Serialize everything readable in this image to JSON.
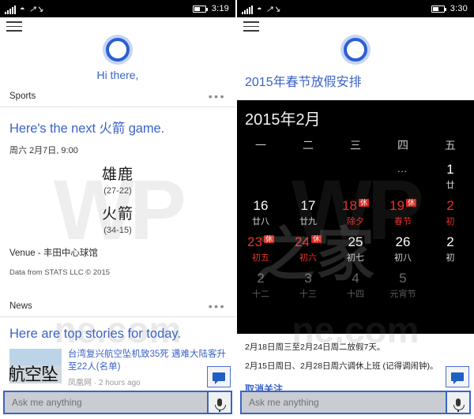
{
  "left": {
    "statusbar": {
      "time": "3:19",
      "signal_icon": "signal-bars-icon",
      "wifi_icon": "wifi-icon",
      "data_icon": "data-icon",
      "battery_icon": "battery-icon"
    },
    "menu_icon": "hamburger-menu-icon",
    "cortana_icon": "cortana-ring-icon",
    "greeting": "Hi there,",
    "sports": {
      "section_title": "Sports",
      "overflow_icon": "more-options-icon",
      "headline": "Here's the next 火箭 game.",
      "gametime": "周六 2月7日, 9:00",
      "teams": [
        {
          "name": "雄鹿",
          "record": "(27-22)"
        },
        {
          "name": "火箭",
          "record": "(34-15)"
        }
      ],
      "venue": "Venue - 丰田中心球馆",
      "data_source": "Data from STATS LLC © 2015"
    },
    "news": {
      "section_title": "News",
      "overflow_icon": "more-options-icon",
      "headline": "Here are top stories for today.",
      "items": [
        {
          "thumb_text": "航空坠",
          "title": "台湾复兴航空坠机致35死 遇难大陆客升至22人(名单)",
          "source": "凤凰网 · 2 hours ago"
        }
      ]
    },
    "chat_button_icon": "speech-bubble-icon",
    "ask_placeholder": "Ask me anything",
    "mic_icon": "microphone-icon"
  },
  "right": {
    "statusbar": {
      "time": "3:30",
      "signal_icon": "signal-bars-icon",
      "wifi_icon": "wifi-icon",
      "data_icon": "data-icon",
      "battery_icon": "battery-icon"
    },
    "menu_icon": "hamburger-menu-icon",
    "cortana_icon": "cortana-ring-icon",
    "title": "2015年春节放假安排",
    "calendar": {
      "month_label": "2015年2月",
      "weekdays": [
        "一",
        "二",
        "三",
        "四",
        "五"
      ],
      "rows": [
        [
          {
            "day": "",
            "lunar": "",
            "style": "blank"
          },
          {
            "day": "",
            "lunar": "",
            "style": "blank"
          },
          {
            "day": "",
            "lunar": "",
            "style": "blank"
          },
          {
            "day": "…",
            "lunar": "",
            "style": "ellipsis"
          },
          {
            "day": "1",
            "lunar": "廿",
            "style": "normal"
          }
        ],
        [
          {
            "day": "16",
            "lunar": "廿八",
            "style": "normal"
          },
          {
            "day": "17",
            "lunar": "廿九",
            "style": "normal"
          },
          {
            "day": "18",
            "lunar": "除夕",
            "style": "red",
            "badge": "休"
          },
          {
            "day": "19",
            "lunar": "春节",
            "style": "red",
            "badge": "休"
          },
          {
            "day": "2",
            "lunar": "初",
            "style": "red"
          }
        ],
        [
          {
            "day": "23",
            "lunar": "初五",
            "style": "red",
            "badge": "休"
          },
          {
            "day": "24",
            "lunar": "初六",
            "style": "red",
            "badge": "休"
          },
          {
            "day": "25",
            "lunar": "初七",
            "style": "normal"
          },
          {
            "day": "26",
            "lunar": "初八",
            "style": "normal"
          },
          {
            "day": "2",
            "lunar": "初",
            "style": "normal"
          }
        ],
        [
          {
            "day": "2",
            "lunar": "十二",
            "style": "dim"
          },
          {
            "day": "3",
            "lunar": "十三",
            "style": "dim"
          },
          {
            "day": "4",
            "lunar": "十四",
            "style": "dim"
          },
          {
            "day": "5",
            "lunar": "元宵节",
            "style": "dim"
          },
          {
            "day": "",
            "lunar": "",
            "style": "dim"
          }
        ]
      ]
    },
    "note1": "2月18日周三至2月24日周二放假7天。",
    "note2": "2月15日周日、2月28日周六调休上班 (记得调闹钟)。",
    "unfollow": "取消关注",
    "chat_button_icon": "speech-bubble-icon",
    "ask_placeholder": "Ask me anything",
    "mic_icon": "microphone-icon"
  },
  "watermark": {
    "big": "WP",
    "sub": "ne.com",
    "cn": "之家"
  }
}
